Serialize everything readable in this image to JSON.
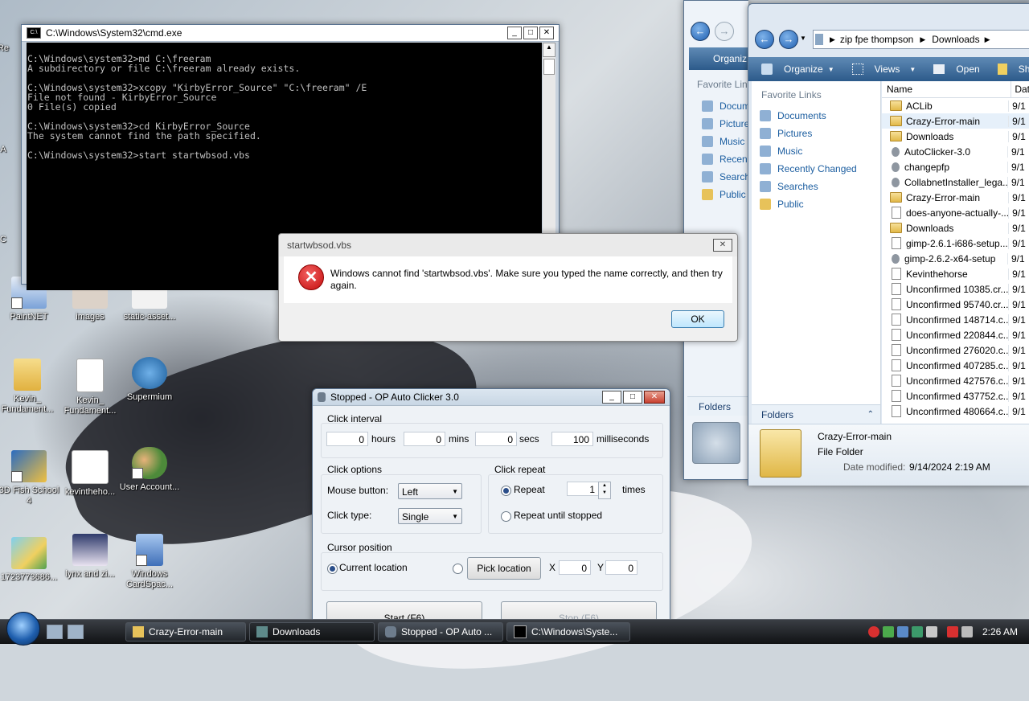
{
  "desktop": {
    "icons": [
      {
        "label": "PaintNET"
      },
      {
        "label": "images"
      },
      {
        "label": "static-asset..."
      },
      {
        "label": "Kevin_ Fundament..."
      },
      {
        "label": "Kevin_ Fundament..."
      },
      {
        "label": "Supermium"
      },
      {
        "label": "3D Fish School 4"
      },
      {
        "label": "kevintheho..."
      },
      {
        "label": "User Account..."
      },
      {
        "label": "1723773686..."
      },
      {
        "label": "lynx and zi..."
      },
      {
        "label": "Windows CardSpac..."
      }
    ],
    "edge_labels": [
      "Re",
      "A",
      "C"
    ]
  },
  "cmd": {
    "title": "C:\\Windows\\System32\\cmd.exe",
    "lines": "C:\\Windows\\system32>md C:\\freeram\nA subdirectory or file C:\\freeram already exists.\n\nC:\\Windows\\system32>xcopy \"KirbyError_Source\" \"C:\\freeram\" /E\nFile not found - KirbyError_Source\n0 File(s) copied\n\nC:\\Windows\\system32>cd KirbyError_Source\nThe system cannot find the path specified.\n\nC:\\Windows\\system32>start startwbsod.vbs"
  },
  "error_dialog": {
    "title": "startwbsod.vbs",
    "message": "Windows cannot find 'startwbsod.vbs'. Make sure you typed the name correctly, and then try again.",
    "ok_label": "OK"
  },
  "clicker": {
    "title": "Stopped - OP Auto Clicker 3.0",
    "click_interval_label": "Click interval",
    "hours_value": "0",
    "hours_label": "hours",
    "mins_value": "0",
    "mins_label": "mins",
    "secs_value": "0",
    "secs_label": "secs",
    "ms_value": "100",
    "ms_label": "milliseconds",
    "click_options_label": "Click options",
    "mouse_button_label": "Mouse button:",
    "mouse_button_value": "Left",
    "click_type_label": "Click type:",
    "click_type_value": "Single",
    "click_repeat_label": "Click repeat",
    "repeat_label": "Repeat",
    "repeat_value": "1",
    "times_label": "times",
    "repeat_until_stopped_label": "Repeat until stopped",
    "cursor_position_label": "Cursor position",
    "current_location_label": "Current location",
    "pick_location_label": "Pick location",
    "x_label": "X",
    "x_value": "0",
    "y_label": "Y",
    "y_value": "0",
    "start_label": "Start (F6)",
    "stop_label": "Stop (F6)"
  },
  "explorer_back": {
    "toolbar_label": "Organiz",
    "favorite_links_label": "Favorite Lin",
    "links": [
      "Docume",
      "Pictures",
      "Music",
      "Recently",
      "Searche",
      "Public"
    ],
    "folders_label": "Folders"
  },
  "explorer": {
    "breadcrumb": [
      "zip fpe thompson",
      "Downloads"
    ],
    "toolbar": {
      "organize": "Organize",
      "views": "Views",
      "open": "Open",
      "share": "Share"
    },
    "favorite_links_label": "Favorite Links",
    "links": [
      "Documents",
      "Pictures",
      "Music",
      "Recently Changed",
      "Searches",
      "Public"
    ],
    "folders_label": "Folders",
    "columns": {
      "name": "Name",
      "date": "Dat"
    },
    "files": [
      {
        "name": "ACLib",
        "type": "folder",
        "date": "9/1"
      },
      {
        "name": "Crazy-Error-main",
        "type": "folder",
        "date": "9/1"
      },
      {
        "name": "Downloads",
        "type": "folder",
        "date": "9/1"
      },
      {
        "name": "AutoClicker-3.0",
        "type": "app",
        "date": "9/1"
      },
      {
        "name": "changepfp",
        "type": "app",
        "date": "9/1"
      },
      {
        "name": "CollabnetInstaller_lega...",
        "type": "app",
        "date": "9/1"
      },
      {
        "name": "Crazy-Error-main",
        "type": "folder",
        "date": "9/1"
      },
      {
        "name": "does-anyone-actually-...",
        "type": "file",
        "date": "9/1"
      },
      {
        "name": "Downloads",
        "type": "folder",
        "date": "9/1"
      },
      {
        "name": "gimp-2.6.1-i686-setup....",
        "type": "file",
        "date": "9/1"
      },
      {
        "name": "gimp-2.6.2-x64-setup",
        "type": "app",
        "date": "9/1"
      },
      {
        "name": "Kevinthehorse",
        "type": "file",
        "date": "9/1"
      },
      {
        "name": "Unconfirmed 10385.cr...",
        "type": "file",
        "date": "9/1"
      },
      {
        "name": "Unconfirmed 95740.cr...",
        "type": "file",
        "date": "9/1"
      },
      {
        "name": "Unconfirmed 148714.c...",
        "type": "file",
        "date": "9/1"
      },
      {
        "name": "Unconfirmed 220844.c...",
        "type": "file",
        "date": "9/1"
      },
      {
        "name": "Unconfirmed 276020.c...",
        "type": "file",
        "date": "9/1"
      },
      {
        "name": "Unconfirmed 407285.c...",
        "type": "file",
        "date": "9/1"
      },
      {
        "name": "Unconfirmed 427576.c...",
        "type": "file",
        "date": "9/1"
      },
      {
        "name": "Unconfirmed 437752.c...",
        "type": "file",
        "date": "9/1"
      },
      {
        "name": "Unconfirmed 480664.c...",
        "type": "file",
        "date": "9/1"
      }
    ],
    "details": {
      "name": "Crazy-Error-main",
      "type": "File Folder",
      "date_label": "Date modified:",
      "date_value": "9/14/2024 2:19 AM"
    }
  },
  "taskbar": {
    "buttons": [
      "Crazy-Error-main",
      "Downloads",
      "Stopped - OP Auto ...",
      "C:\\Windows\\Syste..."
    ],
    "clock": "2:26 AM"
  }
}
